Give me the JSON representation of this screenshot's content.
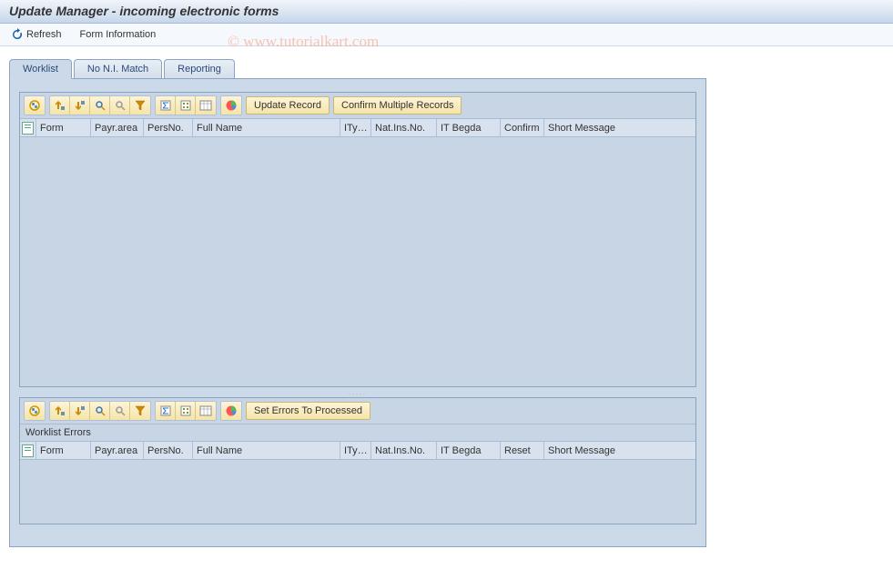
{
  "header": {
    "title": "Update Manager - incoming electronic forms"
  },
  "menu": {
    "refresh": "Refresh",
    "form_info": "Form Information"
  },
  "watermark": "© www.tutorialkart.com",
  "tabs": {
    "worklist": "Worklist",
    "no_ni_match": "No N.I. Match",
    "reporting": "Reporting"
  },
  "toolbar_top": {
    "update_record": "Update Record",
    "confirm_multiple": "Confirm Multiple Records"
  },
  "toolbar_bottom": {
    "set_errors": "Set Errors To Processed"
  },
  "grid_top": {
    "columns": {
      "form": "Form",
      "payr_area": "Payr.area",
      "pers_no": "PersNo.",
      "full_name": "Full Name",
      "ity": "ITy…",
      "nat_ins_no": "Nat.Ins.No.",
      "it_begda": "IT Begda",
      "confirm": "Confirm",
      "short_message": "Short Message"
    }
  },
  "grid_bottom": {
    "label": "Worklist Errors",
    "columns": {
      "form": "Form",
      "payr_area": "Payr.area",
      "pers_no": "PersNo.",
      "full_name": "Full Name",
      "ity": "ITy…",
      "nat_ins_no": "Nat.Ins.No.",
      "it_begda": "IT Begda",
      "reset": "Reset",
      "short_message": "Short Message"
    }
  },
  "icons": {
    "details": "details-icon",
    "print": "print-icon",
    "print_preview": "print-preview-icon",
    "export": "export-icon",
    "find": "find-icon",
    "filter": "filter-icon",
    "sum": "sum-icon",
    "subtotal": "subtotal-icon",
    "layout": "layout-icon",
    "chart": "chart-icon"
  }
}
